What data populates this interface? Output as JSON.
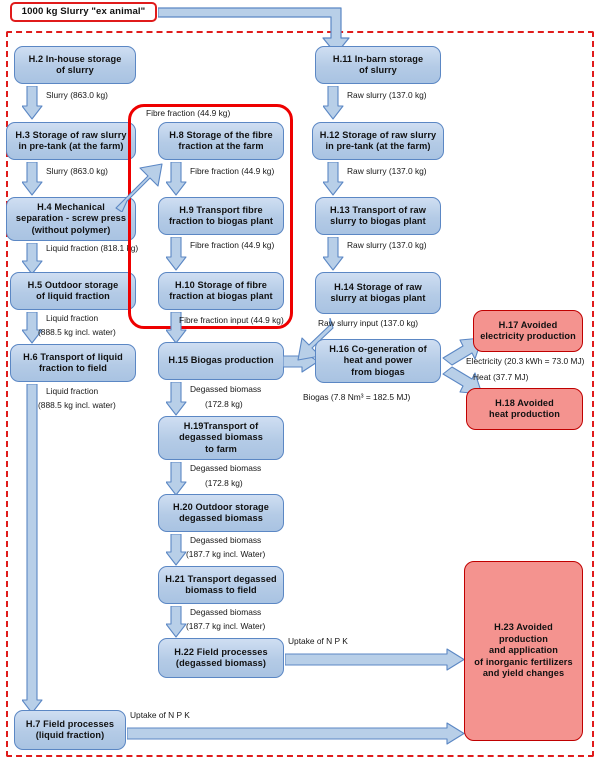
{
  "diagram": {
    "title_box": "1000 kg Slurry \"ex animal\"",
    "colors": {
      "box_fill_blue": "#b4cbe6",
      "box_border_blue": "#5b87c4",
      "box_fill_red": "#f4938f",
      "box_border_red": "#c00000",
      "boundary_dashed": "#e01b1b",
      "highlight_loop": "#ee0000",
      "arrow_fill": "#b8cfe8",
      "arrow_stroke": "#5b87c4"
    },
    "boxes": [
      {
        "id": "H.2",
        "label": "H.2 In-house storage\nof slurry"
      },
      {
        "id": "H.3",
        "label": "H.3 Storage of raw slurry\nin pre-tank (at the farm)"
      },
      {
        "id": "H.4",
        "label": "H.4 Mechanical\nseparation - screw press\n(without polymer)"
      },
      {
        "id": "H.5",
        "label": "H.5 Outdoor storage\nof liquid fraction"
      },
      {
        "id": "H.6",
        "label": "H.6 Transport of liquid\nfraction to field"
      },
      {
        "id": "H.7",
        "label": "H.7 Field processes\n(liquid fraction)"
      },
      {
        "id": "H.8",
        "label": "H.8 Storage of the fibre\nfraction at the farm"
      },
      {
        "id": "H.9",
        "label": "H.9 Transport fibre\nfraction to biogas plant"
      },
      {
        "id": "H.10",
        "label": "H.10 Storage of fibre\nfraction at biogas plant"
      },
      {
        "id": "H.11",
        "label": "H.11 In-barn storage\nof slurry"
      },
      {
        "id": "H.12",
        "label": "H.12 Storage of raw slurry\nin pre-tank (at the farm)"
      },
      {
        "id": "H.13",
        "label": "H.13 Transport of raw\nslurry to biogas plant"
      },
      {
        "id": "H.14",
        "label": "H.14 Storage of raw\nslurry at biogas plant"
      },
      {
        "id": "H.15",
        "label": "H.15 Biogas production"
      },
      {
        "id": "H.16",
        "label": "H.16 Co-generation of\nheat and power\nfrom biogas"
      },
      {
        "id": "H.17",
        "label": "H.17 Avoided\nelectricity production"
      },
      {
        "id": "H.18",
        "label": "H.18 Avoided\nheat production"
      },
      {
        "id": "H.19",
        "label": "H.19Transport of\ndegassed biomass\nto farm"
      },
      {
        "id": "H.20",
        "label": "H.20 Outdoor storage\ndegassed biomass"
      },
      {
        "id": "H.21",
        "label": "H.21 Transport degassed\nbiomass to field"
      },
      {
        "id": "H.22",
        "label": "H.22 Field processes\n(degassed biomass)"
      },
      {
        "id": "H.23",
        "label": "H.23 Avoided\nproduction\nand application\nof inorganic fertilizers\nand yield changes"
      }
    ],
    "flow_labels": {
      "l_slurry_863_a": "Slurry (863.0 kg)",
      "l_slurry_863_b": "Slurry (863.0 kg)",
      "l_liquid_818": "Liquid fraction (818.1 kg)",
      "l_liquid_888_a_1": "Liquid fraction",
      "l_liquid_888_a_2": "(888.5 kg incl. water)",
      "l_liquid_888_b_1": "Liquid fraction",
      "l_liquid_888_b_2": "(888.5 kg incl. water)",
      "l_fibre_top": "Fibre fraction (44.9 kg)",
      "l_fibre_a": "Fibre fraction (44.9 kg)",
      "l_fibre_b": "Fibre fraction (44.9 kg)",
      "l_fibre_input": "Fibre fraction input (44.9 kg)",
      "l_raw_137_a": "Raw slurry (137.0 kg)",
      "l_raw_137_b": "Raw slurry (137.0 kg)",
      "l_raw_137_c": "Raw slurry (137.0 kg)",
      "l_raw_input": "Raw slurry input (137.0 kg)",
      "l_biogas": "Biogas (7.8 Nm³ = 182.5 MJ)",
      "l_electricity": "Electricity (20.3 kWh = 73.0 MJ)",
      "l_heat": "Heat (37.7 MJ)",
      "l_degassed_172_a_1": "Degassed biomass",
      "l_degassed_172_a_2": "(172.8 kg)",
      "l_degassed_172_b_1": "Degassed biomass",
      "l_degassed_172_b_2": "(172.8 kg)",
      "l_degassed_187_a_1": "Degassed biomass",
      "l_degassed_187_a_2": "(187.7 kg incl. Water)",
      "l_degassed_187_b_1": "Degassed biomass",
      "l_degassed_187_b_2": "(187.7 kg incl. Water)",
      "l_uptake_a": "Uptake of N P K",
      "l_uptake_b": "Uptake of N P K"
    }
  }
}
